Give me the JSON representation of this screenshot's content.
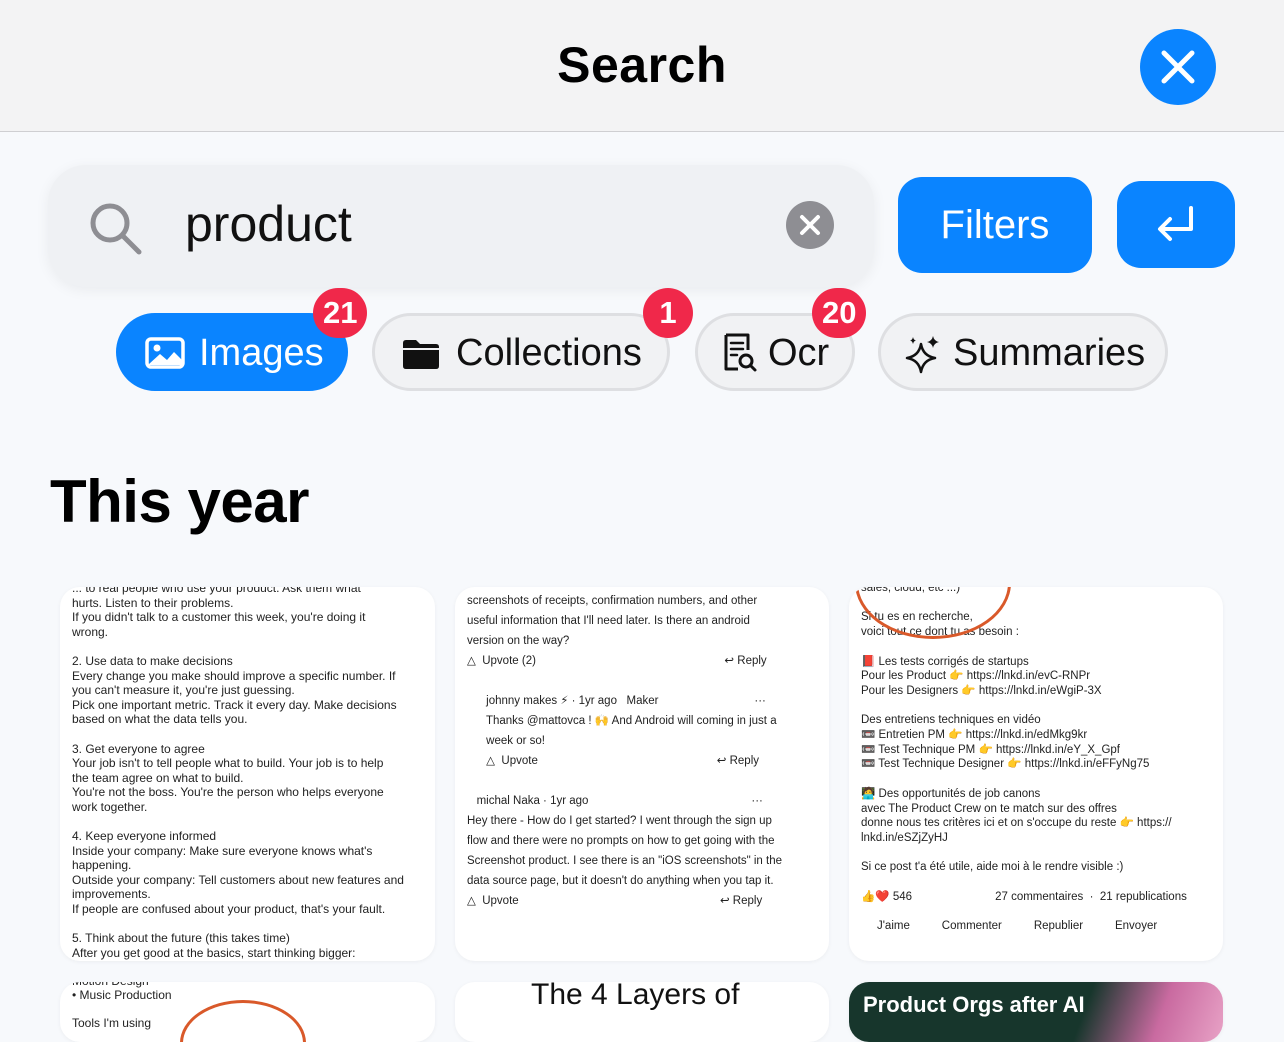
{
  "header": {
    "title": "Search"
  },
  "search": {
    "query": "product"
  },
  "actions": {
    "filters_label": "Filters"
  },
  "categories": [
    {
      "label": "Images",
      "count": "21",
      "active": true
    },
    {
      "label": "Collections",
      "count": "1"
    },
    {
      "label": "Ocr",
      "count": "20"
    },
    {
      "label": "Summaries",
      "count": ""
    }
  ],
  "section": {
    "title": "This year"
  },
  "results": [
    {
      "text": "... to real people who use your product. Ask them what\nhurts. Listen to their problems.\nIf you didn't talk to a customer this week, you're doing it\nwrong.\n\n2. Use data to make decisions\nEvery change you make should improve a specific number. If\nyou can't measure it, you're just guessing.\nPick one important metric. Track it every day. Make decisions\nbased on what the data tells you.\n\n3. Get everyone to agree\nYour job isn't to tell people what to build. Your job is to help\nthe team agree on what to build.\nYou're not the boss. You're the person who helps everyone\nwork together.\n\n4. Keep everyone informed\nInside your company: Make sure everyone knows what's\nhappening.\nOutside your company: Tell customers about new features and\nimprovements.\nIf people are confused about your product, that's your fault.\n\n5. Think about the future (this takes time)\nAfter you get good at the basics, start thinking bigger:"
    },
    {
      "text": "screenshots of receipts, confirmation numbers, and other\nuseful information that I'll need later. Is there an android\nversion on the way?\n△  Upvote (2)                                                           ↩ Reply\n\n      johnny makes ⚡ · 1yr ago   Maker                              ···\n      Thanks @mattovca ! 🙌 And Android will coming in just a\n      week or so!\n      △  Upvote                                                        ↩ Reply\n\n   michal Naka · 1yr ago                                                   ···\nHey there - How do I get started? I went through the sign up\nflow and there were no prompts on how to get going with the\nScreenshot product. I see there is an \"iOS screenshots\" in the\ndata source page, but it doesn't do anything when you tap it.\n△  Upvote                                                               ↩ Reply"
    },
    {
      "text": "sales, cloud, etc ...)\n\nSi tu es en recherche,\nvoici tout ce dont tu as besoin :\n\n📕 Les tests corrigés de startups\nPour les Product 👉 https://lnkd.in/evC-RNPr\nPour les Designers 👉 https://lnkd.in/eWgiP-3X\n\nDes entretiens techniques en vidéo\n📼 Entretien PM 👉 https://lnkd.in/edMkg9kr\n📼 Test Technique PM 👉 https://lnkd.in/eY_X_Gpf\n📼 Test Technique Designer 👉 https://lnkd.in/eFFyNg75\n\n🧑‍💻 Des opportunités de job canons\navec The Product Crew on te match sur des offres\ndonne nous tes critères ici et on s'occupe du reste 👉 https://\nlnkd.in/eSZjZyHJ\n\nSi ce post t'a été utile, aide moi à le rendre visible :)\n\n👍❤️ 546                          27 commentaires  ·  21 republications\n\n     J'aime          Commenter          Republier          Envoyer"
    },
    {
      "text": "Motion Design\n• Music Production\n\nTools I'm using"
    },
    {
      "text": "The 4 Layers of"
    },
    {
      "text": "Product Orgs after AI"
    }
  ],
  "colors": {
    "accent": "#0a84ff",
    "badge": "#f0284a"
  }
}
